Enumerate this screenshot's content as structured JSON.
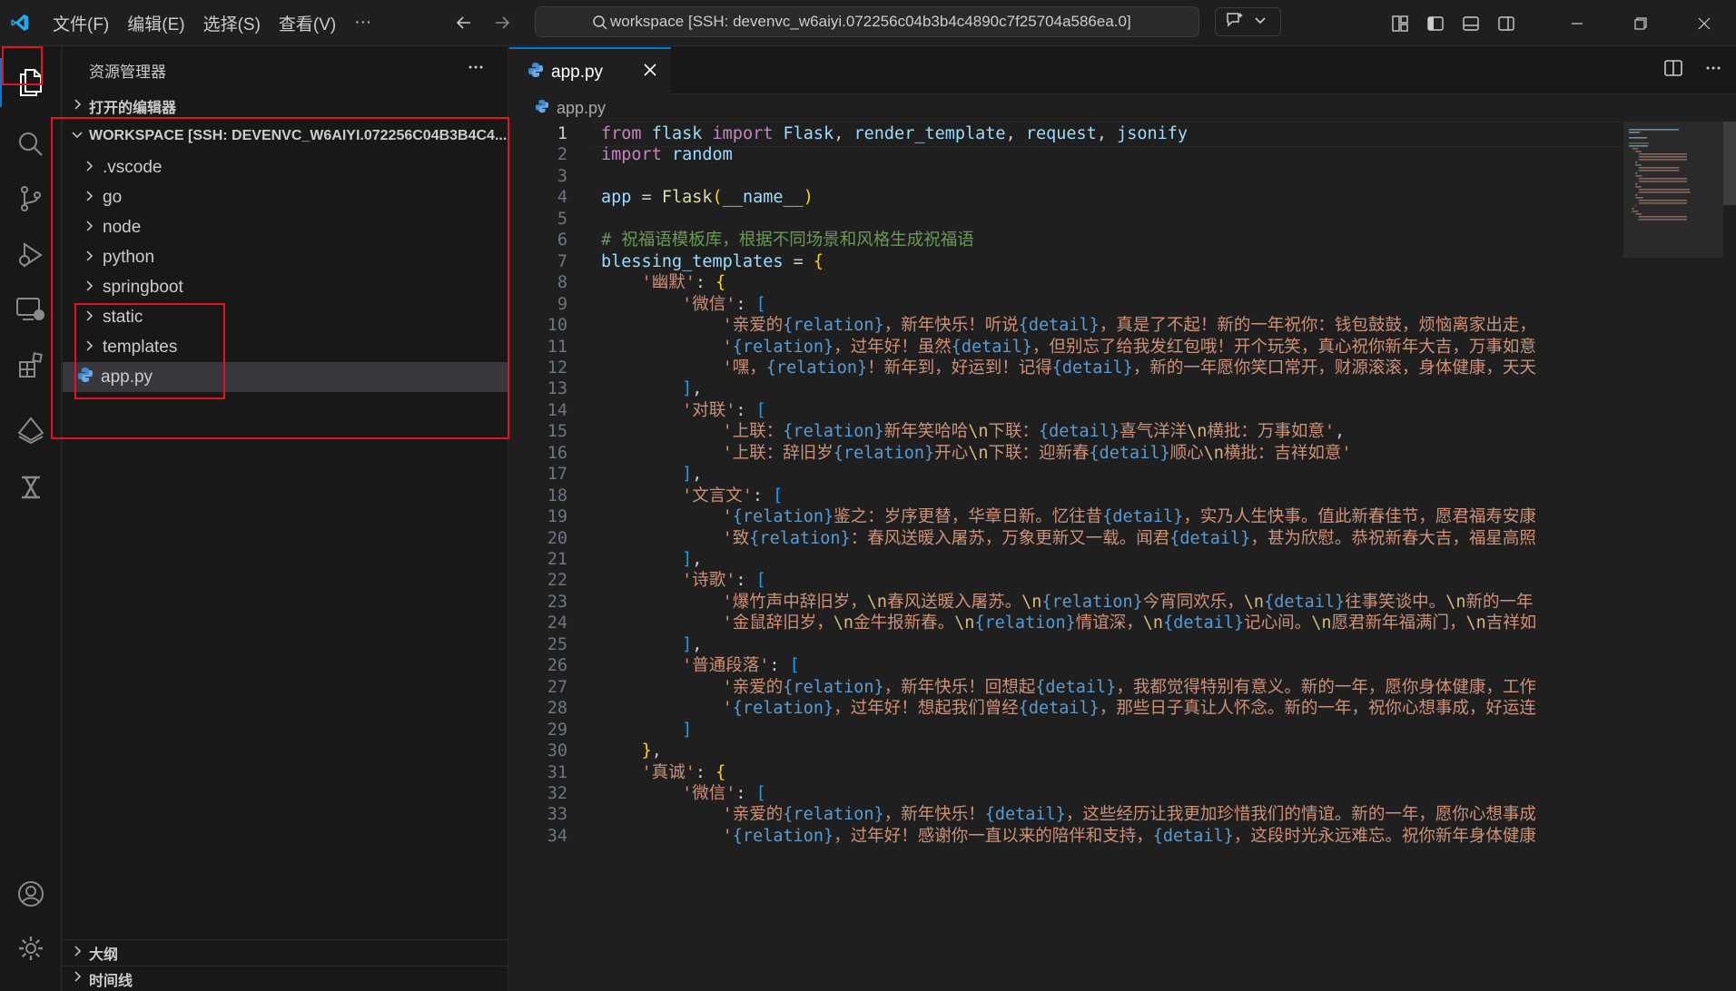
{
  "titlebar": {
    "menus": [
      "文件(F)",
      "编辑(E)",
      "选择(S)",
      "查看(V)",
      "···"
    ],
    "search_text": "workspace [SSH: devenvc_w6aiyi.072256c04b3b4c4890c7f25704a586ea.0]"
  },
  "sidebar": {
    "title": "资源管理器",
    "open_editors": "打开的编辑器",
    "workspace": "WORKSPACE [SSH: DEVENVC_W6AIYI.072256C04B3B4C4...",
    "items": [
      ".vscode",
      "go",
      "node",
      "python",
      "springboot",
      "static",
      "templates",
      "app.py"
    ],
    "outline": "大纲",
    "timeline": "时间线"
  },
  "editor": {
    "tab_label": "app.py",
    "breadcrumb": "app.py",
    "current_line": 1,
    "lines": [
      "from flask import Flask, render_template, request, jsonify",
      "import random",
      "",
      "app = Flask(__name__)",
      "",
      "# 祝福语模板库，根据不同场景和风格生成祝福语",
      "blessing_templates = {",
      "    '幽默': {",
      "        '微信': [",
      "            '亲爱的{relation}，新年快乐！听说{detail}，真是了不起！新的一年祝你：钱包鼓鼓，烦恼离家出走，",
      "            '{relation}，过年好！虽然{detail}，但别忘了给我发红包哦！开个玩笑，真心祝你新年大吉，万事如意",
      "            '嘿，{relation}！新年到，好运到！记得{detail}，新的一年愿你笑口常开，财源滚滚，身体健康，天天",
      "        ],",
      "        '对联': [",
      "            '上联：{relation}新年笑哈哈\\n下联：{detail}喜气洋洋\\n横批：万事如意',",
      "            '上联：辞旧岁{relation}开心\\n下联：迎新春{detail}顺心\\n横批：吉祥如意'",
      "        ],",
      "        '文言文': [",
      "            '{relation}鉴之：岁序更替，华章日新。忆往昔{detail}，实乃人生快事。值此新春佳节，愿君福寿安康",
      "            '致{relation}：春风送暖入屠苏，万象更新又一载。闻君{detail}，甚为欣慰。恭祝新春大吉，福星高照",
      "        ],",
      "        '诗歌': [",
      "            '爆竹声中辞旧岁，\\n春风送暖入屠苏。\\n{relation}今宵同欢乐，\\n{detail}往事笑谈中。\\n新的一年",
      "            '金鼠辞旧岁，\\n金牛报新春。\\n{relation}情谊深，\\n{detail}记心间。\\n愿君新年福满门，\\n吉祥如",
      "        ],",
      "        '普通段落': [",
      "            '亲爱的{relation}，新年快乐！回想起{detail}，我都觉得特别有意义。新的一年，愿你身体健康，工作",
      "            '{relation}，过年好！想起我们曾经{detail}，那些日子真让人怀念。新的一年，祝你心想事成，好运连",
      "        ]",
      "    },",
      "    '真诚': {",
      "        '微信': [",
      "            '亲爱的{relation}，新年快乐！{detail}，这些经历让我更加珍惜我们的情谊。新的一年，愿你心想事成",
      "            '{relation}，过年好！感谢你一直以来的陪伴和支持，{detail}，这段时光永远难忘。祝你新年身体健康"
    ]
  },
  "colors": {
    "accent": "#0078d4",
    "annotation_box": "#e81123",
    "keyword": "#c586c0",
    "string": "#ce9178",
    "comment": "#6a9955"
  }
}
